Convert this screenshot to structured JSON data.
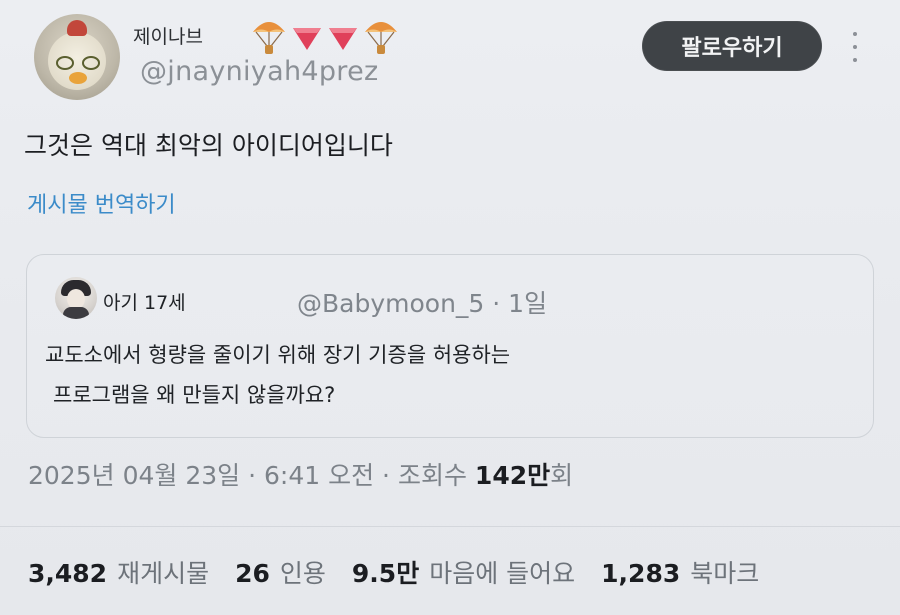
{
  "author": {
    "display_name": "제이나브",
    "handle": "@jnayniyah4prez",
    "name_emojis": [
      "parachute-icon",
      "red-triangle-down-icon",
      "red-triangle-down-icon",
      "parachute-icon"
    ]
  },
  "header": {
    "follow_label": "팔로우하기"
  },
  "post": {
    "text": "그것은 역대 최악의 아이디어입니다",
    "translate_label": "게시물 번역하기"
  },
  "quoted": {
    "name": "아기 17세",
    "handle_time": "@Babymoon_5 · 1일",
    "line1": "교도소에서 형량을 줄이기 위해 장기 기증을 허용하는",
    "line2": "프로그램을 왜 만들지 않을까요?"
  },
  "meta": {
    "date": "2025년 04월 23일",
    "time": "6:41 오전",
    "views_prefix": "조회수",
    "views_value": "142만",
    "views_suffix": "회",
    "separator": "·"
  },
  "stats": {
    "reposts": "3,482",
    "reposts_label": "재게시물",
    "quotes": "26",
    "quotes_label": "인용",
    "likes": "9.5만",
    "likes_label": "마음에 들어요",
    "bookmarks": "1,283",
    "bookmarks_label": "북마크"
  },
  "colors": {
    "link": "#3b8bc9",
    "follow_button_bg": "#3f4347",
    "emoji_red": "#e0405a",
    "secondary_text": "#7c8289"
  }
}
